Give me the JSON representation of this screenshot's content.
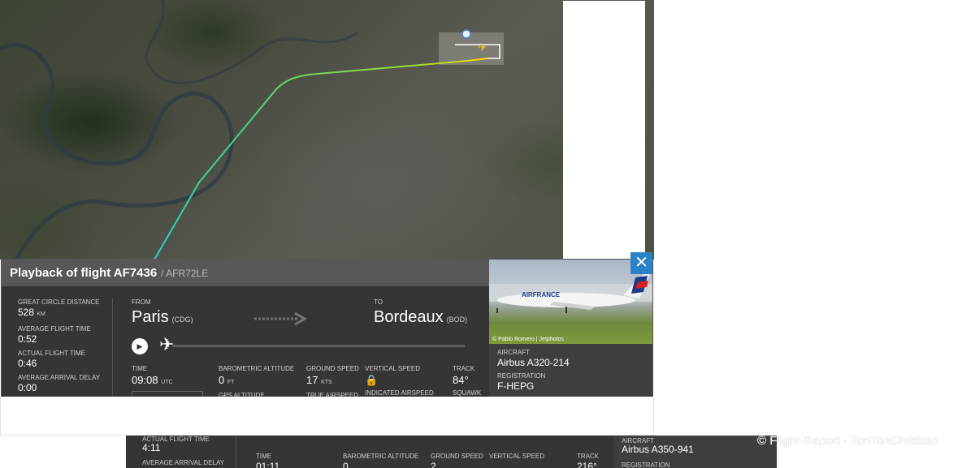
{
  "panel": {
    "title": "Playback of flight AF7436",
    "callsign": "/ AFR72LE",
    "stats": [
      {
        "label": "GREAT CIRCLE DISTANCE",
        "value": "528",
        "unit": "KM"
      },
      {
        "label": "AVERAGE FLIGHT TIME",
        "value": "0:52"
      },
      {
        "label": "ACTUAL FLIGHT TIME",
        "value": "0:46"
      },
      {
        "label": "AVERAGE ARRIVAL DELAY",
        "value": "0:00"
      }
    ],
    "from": {
      "label": "FROM",
      "city": "Paris",
      "code": "(CDG)"
    },
    "to": {
      "label": "TO",
      "city": "Bordeaux",
      "code": "(BOD)"
    },
    "telemetry": [
      {
        "label": "TIME",
        "value": "09:08",
        "unit": "UTC",
        "sub": ""
      },
      {
        "label": "BAROMETRIC ALTITUDE",
        "value": "0",
        "unit": "FT",
        "sub": "GPS ALTITUDE"
      },
      {
        "label": "GROUND SPEED",
        "value": "17",
        "unit": "KTS",
        "sub": "TRUE AIRSPEED"
      },
      {
        "label": "VERTICAL SPEED",
        "value": "🔒",
        "unit": "",
        "sub": "INDICATED AIRSPEED"
      },
      {
        "label": "TRACK",
        "value": "84°",
        "unit": "",
        "sub": "SQUAWK"
      }
    ],
    "photo_credit": "© Pablo Romero | Jetphotos",
    "aircraft_label": "AIRCRAFT",
    "aircraft_value": "Airbus A320-214",
    "registration_label": "REGISTRATION",
    "registration_value": "F-HEPG",
    "livery_text": "AIRFRANCE"
  },
  "lower_panel": {
    "actual_flight_time_label": "ACTUAL FLIGHT TIME",
    "actual_flight_time_value": "4:11",
    "average_arrival_delay_label": "AVERAGE ARRIVAL DELAY",
    "time_label": "TIME",
    "time_value": "01:11",
    "baro_label": "BAROMETRIC ALTITUDE",
    "baro_value": "0",
    "ground_speed_label": "GROUND SPEED",
    "ground_speed_value": "2",
    "vertical_speed_label": "VERTICAL SPEED",
    "track_label": "TRACK",
    "track_value": "216°",
    "aircraft_label": "AIRCRAFT",
    "aircraft_value": "Airbus A350-941",
    "registration_label": "REGISTRATION"
  },
  "close_icon": "close-icon",
  "colors": {
    "path_start": "#ffd700",
    "path_mid": "#7fd13b",
    "path_end": "#2ad1b7",
    "close_bg": "#2a83c7"
  },
  "watermark": "© Flight-Report - TonTonChristian"
}
